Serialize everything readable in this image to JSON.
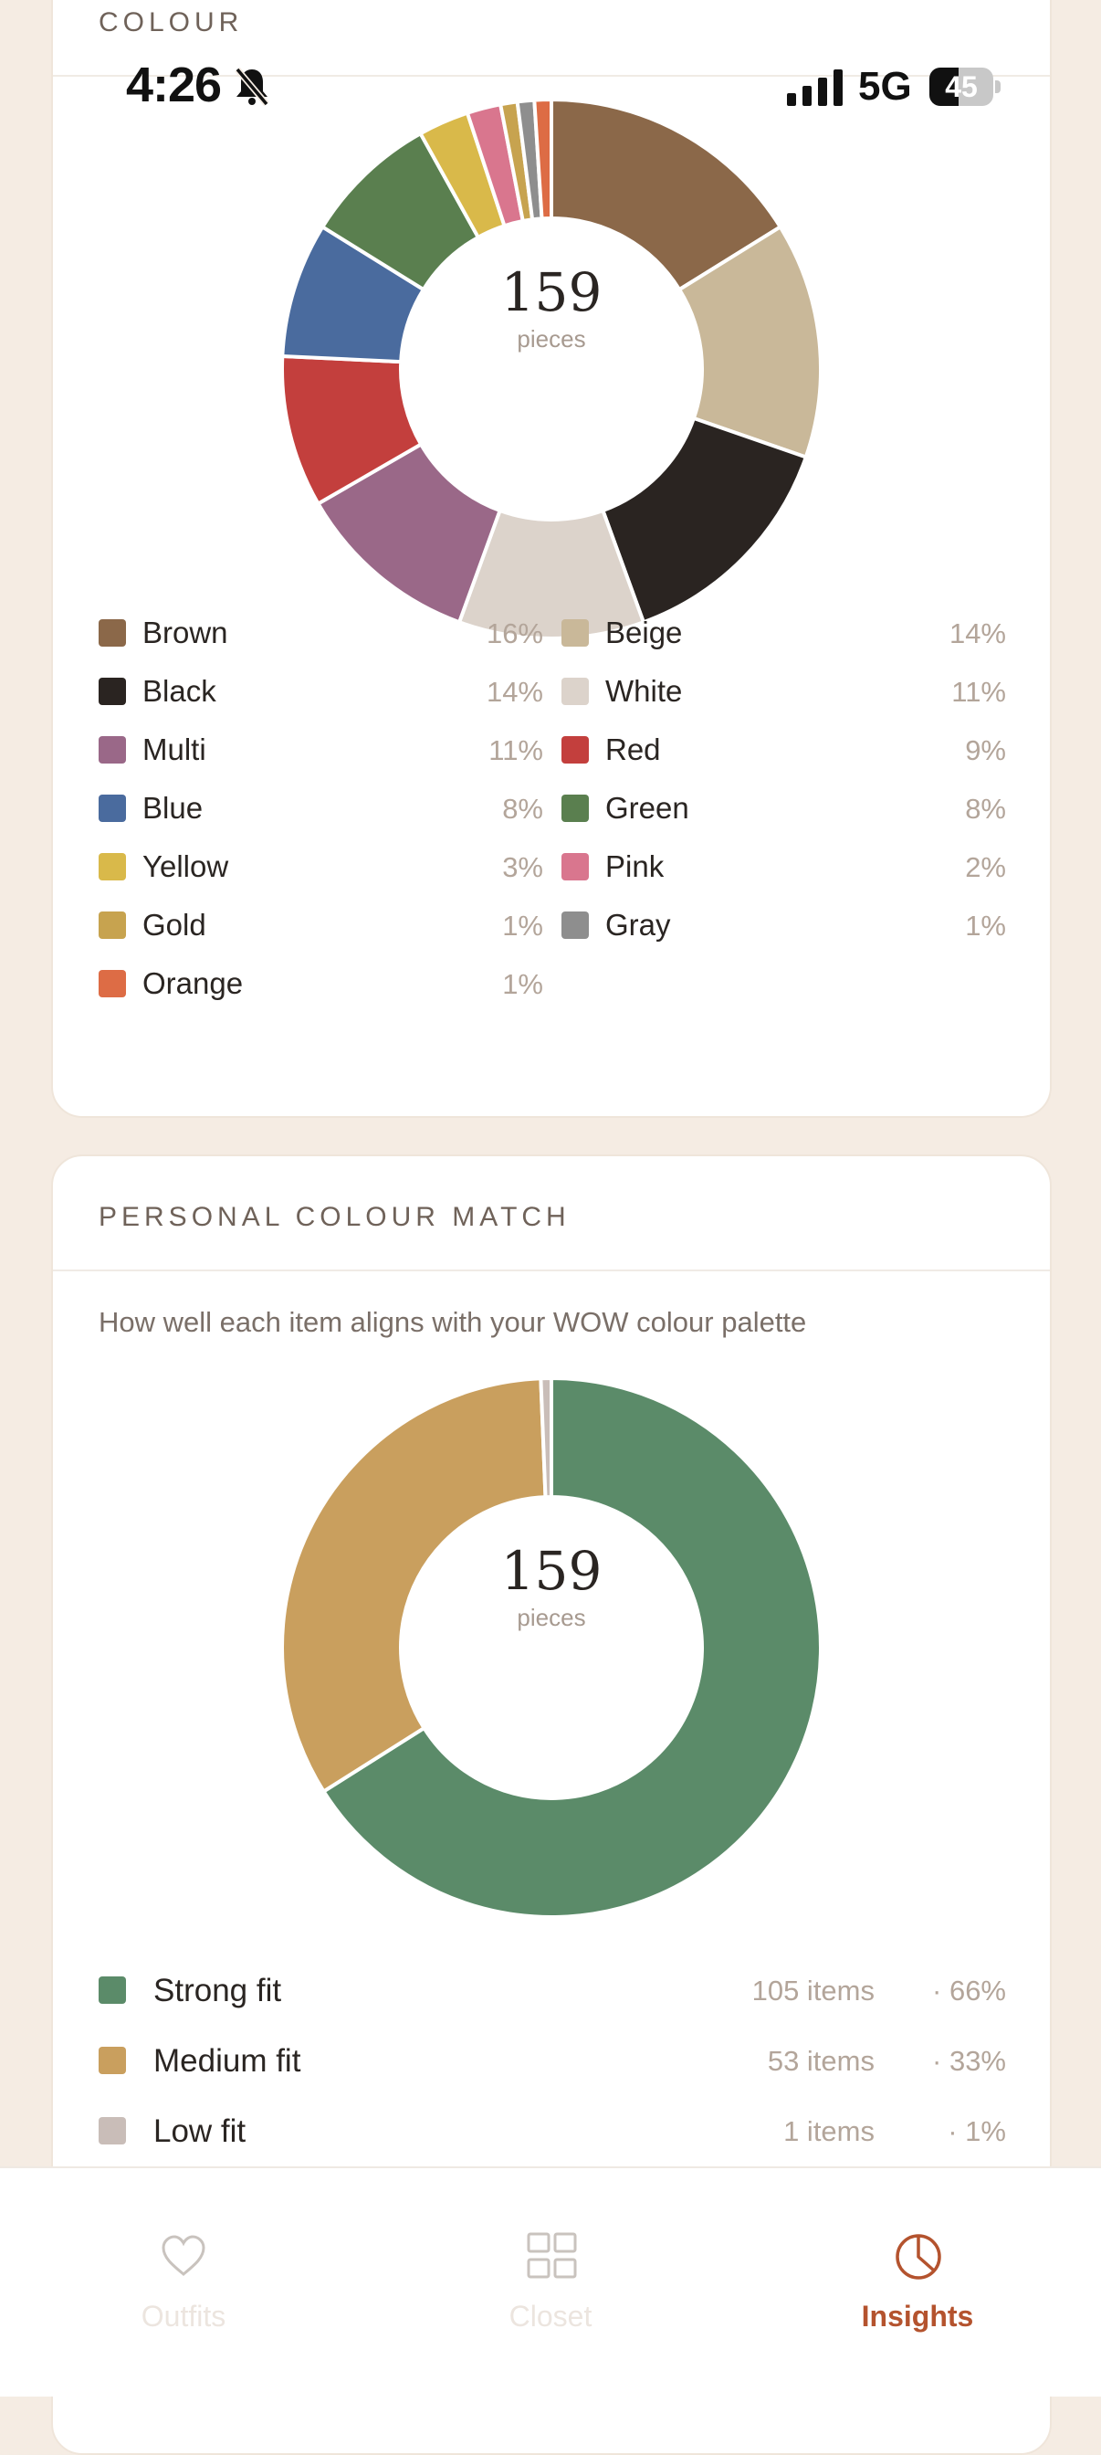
{
  "status_bar": {
    "time": "4:26",
    "network": "5G",
    "battery": "45",
    "battery_level": 0.45
  },
  "colour_card": {
    "title": "COLOUR",
    "center_value": "159",
    "center_unit": "pieces"
  },
  "chart_data": [
    {
      "type": "pie",
      "donut": true,
      "title": "COLOUR",
      "center_label": "159 pieces",
      "categories": [
        "Brown",
        "Beige",
        "Black",
        "White",
        "Multi",
        "Red",
        "Blue",
        "Green",
        "Yellow",
        "Pink",
        "Gold",
        "Gray",
        "Orange"
      ],
      "values": [
        16,
        14,
        14,
        11,
        11,
        9,
        8,
        8,
        3,
        2,
        1,
        1,
        1
      ],
      "labels": [
        "16%",
        "14%",
        "14%",
        "11%",
        "11%",
        "9%",
        "8%",
        "8%",
        "3%",
        "2%",
        "1%",
        "1%",
        "1%"
      ],
      "colors": [
        "#8b6849",
        "#c9b899",
        "#2a2421",
        "#dcd3cb",
        "#9a6888",
        "#c33f3d",
        "#4a6b9e",
        "#5a7f4f",
        "#d9b94a",
        "#d9768e",
        "#c7a34f",
        "#8e8e8e",
        "#dd6c45"
      ]
    },
    {
      "type": "pie",
      "donut": true,
      "title": "PERSONAL COLOUR MATCH",
      "center_label": "159 pieces",
      "categories": [
        "Strong fit",
        "Medium fit",
        "Low fit"
      ],
      "values": [
        105,
        53,
        1
      ],
      "counts": [
        "105 items",
        "53 items",
        "1 items"
      ],
      "labels": [
        "· 66%",
        "· 33%",
        "· 1%"
      ],
      "colors": [
        "#5b8b69",
        "#c99f5e",
        "#c9bdb8"
      ]
    }
  ],
  "match_card": {
    "title": "PERSONAL COLOUR MATCH",
    "subtitle": "How well each item aligns with your WOW colour palette",
    "center_value": "159",
    "center_unit": "pieces"
  },
  "tabs": [
    {
      "label": "Outfits",
      "icon": "heart-icon",
      "active": false
    },
    {
      "label": "Closet",
      "icon": "grid-icon",
      "active": false
    },
    {
      "label": "Insights",
      "icon": "pie-chart-icon",
      "active": true
    }
  ],
  "colors": {
    "accent": "#b4532e",
    "background": "#f5ece3",
    "card": "#ffffff"
  }
}
